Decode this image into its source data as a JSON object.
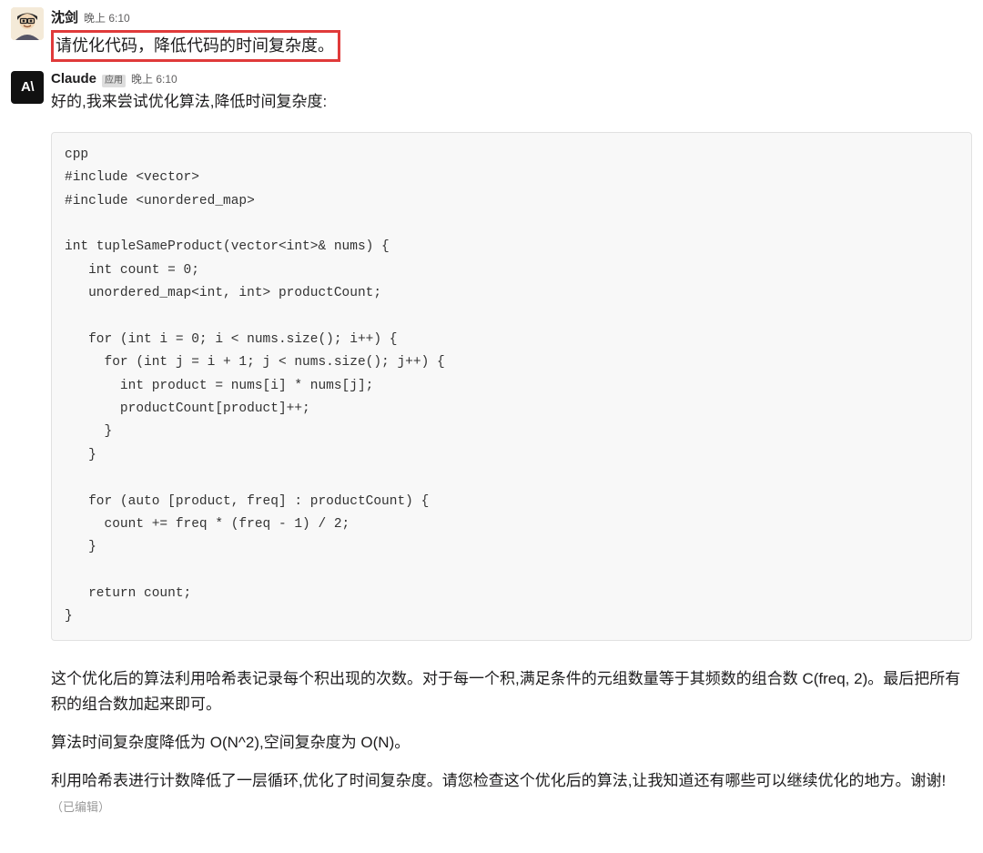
{
  "user_message": {
    "name": "沈剑",
    "time": "晚上 6:10",
    "text": "请优化代码，降低代码的时间复杂度。"
  },
  "claude_message": {
    "name": "Claude",
    "app_badge": "应用",
    "time": "晚上 6:10",
    "avatar_text": "A\\",
    "intro": "好的,我来尝试优化算法,降低时间复杂度:",
    "code": "cpp\n#include <vector>\n#include <unordered_map>\n\nint tupleSameProduct(vector<int>& nums) {\n   int count = 0;\n   unordered_map<int, int> productCount;\n\n   for (int i = 0; i < nums.size(); i++) {\n     for (int j = i + 1; j < nums.size(); j++) {\n       int product = nums[i] * nums[j];\n       productCount[product]++;\n     }\n   }\n\n   for (auto [product, freq] : productCount) {\n     count += freq * (freq - 1) / 2;\n   }\n\n   return count;\n}",
    "explain_p1": "这个优化后的算法利用哈希表记录每个积出现的次数。对于每一个积,满足条件的元组数量等于其频数的组合数 C(freq, 2)。最后把所有积的组合数加起来即可。",
    "explain_p2": "算法时间复杂度降低为 O(N^2),空间复杂度为 O(N)。",
    "explain_p3": "利用哈希表进行计数降低了一层循环,优化了时间复杂度。请您检查这个优化后的算法,让我知道还有哪些可以继续优化的地方。谢谢!",
    "edited": "（已编辑）"
  }
}
